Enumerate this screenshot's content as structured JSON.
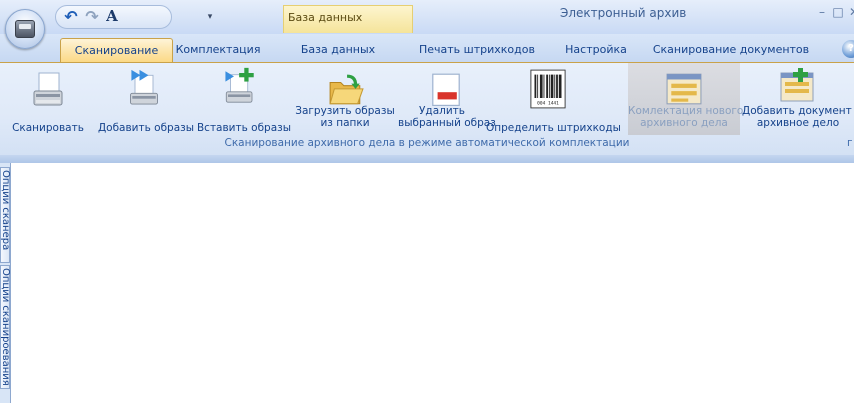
{
  "app": {
    "title": "Электронный архив",
    "context_tab": "База данных",
    "window_controls": {
      "minimize": "–",
      "maximize": "□",
      "close": "✕"
    }
  },
  "quick_access": {
    "undo_icon": "undo-icon",
    "redo_icon": "redo-icon",
    "font_label": "A",
    "menu_arrow": "▾"
  },
  "tabs": [
    {
      "label": "Сканирование",
      "active": true
    },
    {
      "label": "Комплектация",
      "active": false
    },
    {
      "label": "База данных",
      "active": false
    },
    {
      "label": "Печать штрихкодов",
      "active": false
    },
    {
      "label": "Настройка",
      "active": false
    },
    {
      "label": "Сканирование документов",
      "active": false
    }
  ],
  "help_label": "?",
  "ribbon": {
    "buttons": [
      {
        "label": "Сканировать",
        "icon": "scanner-icon"
      },
      {
        "label": "Добавить образы",
        "icon": "add-images-icon"
      },
      {
        "label": "Вставить образы",
        "icon": "insert-images-icon"
      },
      {
        "label_line1": "Загрузить образы",
        "label_line2": "из папки",
        "icon": "folder-open-icon"
      },
      {
        "label_line1": "Удалить",
        "label_line2": "выбранный образ",
        "icon": "delete-image-icon"
      },
      {
        "label": "Определить штрихкоды",
        "icon": "barcode-icon",
        "barcode_text": "004 1441"
      },
      {
        "label_line1": "Комлектация нового",
        "label_line2": "архивного дела",
        "icon": "new-case-icon",
        "disabled": true
      },
      {
        "label_line1": "Добавить документ в",
        "label_line2": "архивное дело",
        "icon": "add-document-icon"
      }
    ],
    "group_label": "Сканирование архивного дела в режиме автоматической комплектации",
    "group_label_right": "г"
  },
  "side_tabs": [
    {
      "label": "Опции сканера"
    },
    {
      "label": "Опции сканироевания"
    }
  ]
}
